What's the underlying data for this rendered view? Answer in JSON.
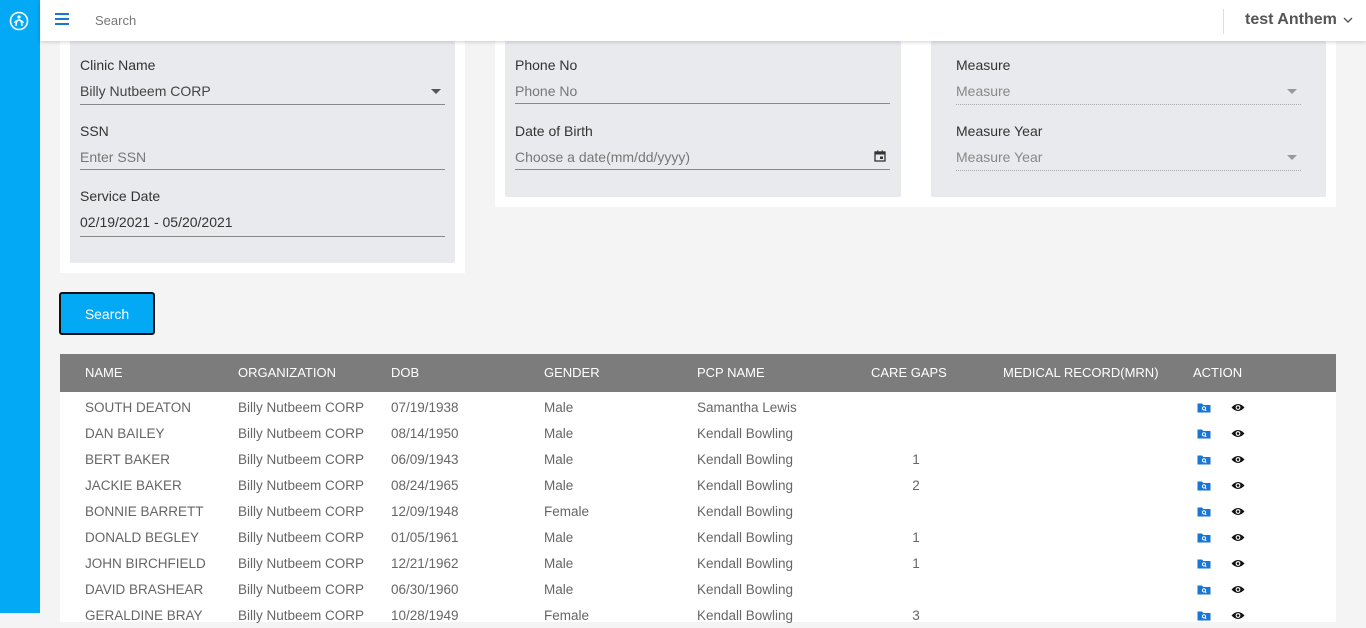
{
  "topbar": {
    "search_placeholder": "Search",
    "user_name": "test Anthem"
  },
  "filters": {
    "clinic_name": {
      "label": "Clinic Name",
      "value": "Billy Nutbeem CORP"
    },
    "ssn": {
      "label": "SSN",
      "placeholder": "Enter SSN"
    },
    "service_date": {
      "label": "Service Date",
      "value": "02/19/2021 - 05/20/2021"
    },
    "phone": {
      "label": "Phone No",
      "placeholder": "Phone No"
    },
    "dob": {
      "label": "Date of Birth",
      "placeholder": "Choose a date(mm/dd/yyyy)"
    },
    "measure": {
      "label": "Measure",
      "placeholder": "Measure"
    },
    "measure_year": {
      "label": "Measure Year",
      "placeholder": "Measure Year"
    }
  },
  "search_button": "Search",
  "table": {
    "headers": [
      "NAME",
      "ORGANIZATION",
      "DOB",
      "GENDER",
      "PCP NAME",
      "CARE GAPS",
      "MEDICAL RECORD(MRN)",
      "ACTION"
    ],
    "rows": [
      {
        "name": "SOUTH DEATON",
        "org": "Billy Nutbeem CORP",
        "dob": "07/19/1938",
        "gender": "Male",
        "pcp": "Samantha Lewis",
        "care_gaps": "",
        "mrn": ""
      },
      {
        "name": "DAN BAILEY",
        "org": "Billy Nutbeem CORP",
        "dob": "08/14/1950",
        "gender": "Male",
        "pcp": "Kendall Bowling",
        "care_gaps": "",
        "mrn": ""
      },
      {
        "name": "BERT BAKER",
        "org": "Billy Nutbeem CORP",
        "dob": "06/09/1943",
        "gender": "Male",
        "pcp": "Kendall Bowling",
        "care_gaps": "1",
        "mrn": ""
      },
      {
        "name": "JACKIE BAKER",
        "org": "Billy Nutbeem CORP",
        "dob": "08/24/1965",
        "gender": "Male",
        "pcp": "Kendall Bowling",
        "care_gaps": "2",
        "mrn": ""
      },
      {
        "name": "BONNIE BARRETT",
        "org": "Billy Nutbeem CORP",
        "dob": "12/09/1948",
        "gender": "Female",
        "pcp": "Kendall Bowling",
        "care_gaps": "",
        "mrn": ""
      },
      {
        "name": "DONALD BEGLEY",
        "org": "Billy Nutbeem CORP",
        "dob": "01/05/1961",
        "gender": "Male",
        "pcp": "Kendall Bowling",
        "care_gaps": "1",
        "mrn": ""
      },
      {
        "name": "JOHN BIRCHFIELD",
        "org": "Billy Nutbeem CORP",
        "dob": "12/21/1962",
        "gender": "Male",
        "pcp": "Kendall Bowling",
        "care_gaps": "1",
        "mrn": ""
      },
      {
        "name": "DAVID BRASHEAR",
        "org": "Billy Nutbeem CORP",
        "dob": "06/30/1960",
        "gender": "Male",
        "pcp": "Kendall Bowling",
        "care_gaps": "",
        "mrn": ""
      },
      {
        "name": "GERALDINE BRAY",
        "org": "Billy Nutbeem CORP",
        "dob": "10/28/1949",
        "gender": "Female",
        "pcp": "Kendall Bowling",
        "care_gaps": "3",
        "mrn": ""
      }
    ]
  },
  "colors": {
    "sidebar": "#03a9f4",
    "accent": "#1976d2",
    "table_header": "#7c7c7c"
  },
  "icons": {
    "logo": "app-logo-icon",
    "menu": "hamburger-menu-icon",
    "user_dropdown": "chevron-down-icon",
    "row_folder": "folder-search-icon",
    "row_view": "eye-icon",
    "calendar": "calendar-icon"
  }
}
